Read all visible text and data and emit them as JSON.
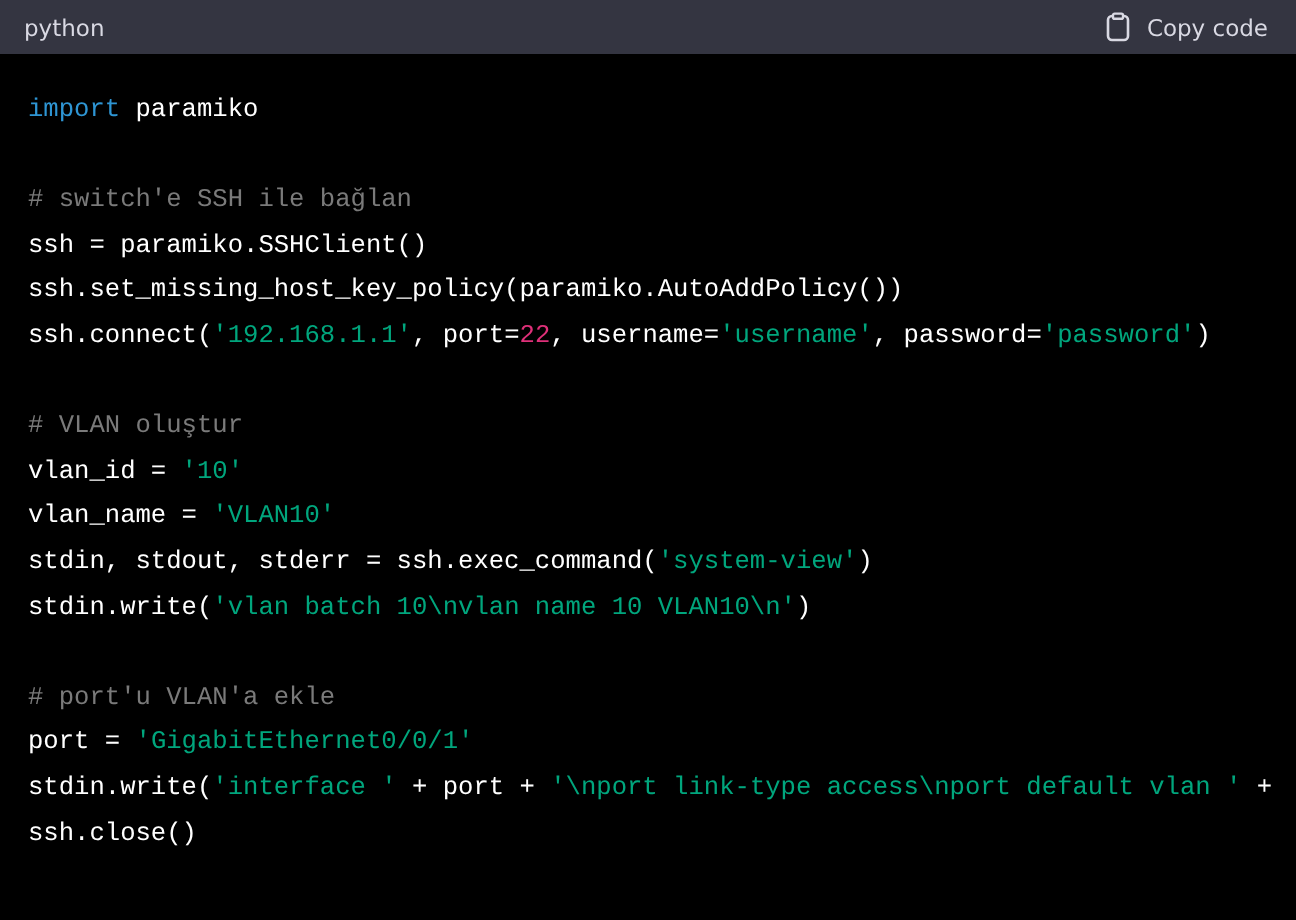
{
  "header": {
    "language": "python",
    "copy_button": "Copy code"
  },
  "lines": [
    {
      "kind": "code",
      "tokens": [
        {
          "kind": "keyword",
          "text": "import"
        },
        {
          "kind": "plain",
          "text": " paramiko"
        }
      ]
    },
    {
      "kind": "blank"
    },
    {
      "kind": "code",
      "tokens": [
        {
          "kind": "comment",
          "text": "# switch'e SSH ile bağlan"
        }
      ]
    },
    {
      "kind": "code",
      "tokens": [
        {
          "kind": "plain",
          "text": "ssh = paramiko.SSHClient()"
        }
      ]
    },
    {
      "kind": "code",
      "tokens": [
        {
          "kind": "plain",
          "text": "ssh.set_missing_host_key_policy(paramiko.AutoAddPolicy())"
        }
      ]
    },
    {
      "kind": "code",
      "tokens": [
        {
          "kind": "plain",
          "text": "ssh.connect("
        },
        {
          "kind": "string",
          "text": "'192.168.1.1'"
        },
        {
          "kind": "plain",
          "text": ", port="
        },
        {
          "kind": "number",
          "text": "22"
        },
        {
          "kind": "plain",
          "text": ", username="
        },
        {
          "kind": "string",
          "text": "'username'"
        },
        {
          "kind": "plain",
          "text": ", password="
        },
        {
          "kind": "string",
          "text": "'password'"
        },
        {
          "kind": "plain",
          "text": ")"
        }
      ]
    },
    {
      "kind": "blank"
    },
    {
      "kind": "code",
      "tokens": [
        {
          "kind": "comment",
          "text": "# VLAN oluştur"
        }
      ]
    },
    {
      "kind": "code",
      "tokens": [
        {
          "kind": "plain",
          "text": "vlan_id = "
        },
        {
          "kind": "string",
          "text": "'10'"
        }
      ]
    },
    {
      "kind": "code",
      "tokens": [
        {
          "kind": "plain",
          "text": "vlan_name = "
        },
        {
          "kind": "string",
          "text": "'VLAN10'"
        }
      ]
    },
    {
      "kind": "code",
      "tokens": [
        {
          "kind": "plain",
          "text": "stdin, stdout, stderr = ssh.exec_command("
        },
        {
          "kind": "string",
          "text": "'system-view'"
        },
        {
          "kind": "plain",
          "text": ")"
        }
      ]
    },
    {
      "kind": "code",
      "tokens": [
        {
          "kind": "plain",
          "text": "stdin.write("
        },
        {
          "kind": "string",
          "text": "'vlan batch 10\\nvlan name 10 VLAN10\\n'"
        },
        {
          "kind": "plain",
          "text": ")"
        }
      ]
    },
    {
      "kind": "blank"
    },
    {
      "kind": "code",
      "tokens": [
        {
          "kind": "comment",
          "text": "# port'u VLAN'a ekle"
        }
      ]
    },
    {
      "kind": "code",
      "tokens": [
        {
          "kind": "plain",
          "text": "port = "
        },
        {
          "kind": "string",
          "text": "'GigabitEthernet0/0/1'"
        }
      ]
    },
    {
      "kind": "code",
      "tokens": [
        {
          "kind": "plain",
          "text": "stdin.write("
        },
        {
          "kind": "string",
          "text": "'interface '"
        },
        {
          "kind": "plain",
          "text": " + port + "
        },
        {
          "kind": "string",
          "text": "'\\nport link-type access\\nport default vlan '"
        },
        {
          "kind": "plain",
          "text": " +"
        }
      ]
    },
    {
      "kind": "code",
      "tokens": [
        {
          "kind": "plain",
          "text": "ssh.close()"
        }
      ]
    }
  ]
}
